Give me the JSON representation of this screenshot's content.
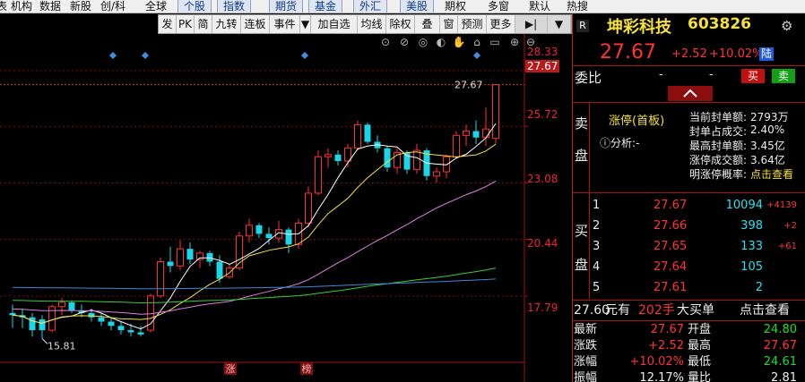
{
  "menu": {
    "items": [
      "表",
      "机构",
      "数据",
      "新股",
      "创/科",
      "全球",
      "个股",
      "指数",
      "期货",
      "基金",
      "外汇",
      "美股",
      "期权",
      "多窗",
      "默认",
      "热搜"
    ]
  },
  "toolbar": {
    "buttons": [
      "发",
      "PK",
      "简",
      "九转",
      "连板",
      "事件",
      "▼",
      "加自选",
      "均线",
      "除权",
      "叠",
      "窗",
      "预测",
      "更多",
      "▶|",
      "▼"
    ]
  },
  "chart_data": {
    "type": "candlestick",
    "y_ticks": [
      "28.33",
      "25.72",
      "23.08",
      "20.44",
      "17.79"
    ],
    "current_price_label": "27.67",
    "high_marker": "27.67",
    "low_marker": "15.81",
    "bottom_markers": [
      "涨",
      "榜"
    ],
    "ylim": [
      15.2,
      29.2
    ],
    "candles": [
      {
        "o": 17.0,
        "h": 17.4,
        "l": 16.3,
        "c": 16.9
      },
      {
        "o": 16.9,
        "h": 17.2,
        "l": 16.3,
        "c": 16.8
      },
      {
        "o": 16.8,
        "h": 17.0,
        "l": 15.9,
        "c": 16.2
      },
      {
        "o": 16.7,
        "h": 16.9,
        "l": 15.81,
        "c": 16.2
      },
      {
        "o": 16.2,
        "h": 17.4,
        "l": 16.1,
        "c": 17.3
      },
      {
        "o": 17.3,
        "h": 17.7,
        "l": 16.9,
        "c": 17.5
      },
      {
        "o": 17.5,
        "h": 17.6,
        "l": 17.0,
        "c": 17.1
      },
      {
        "o": 17.1,
        "h": 17.4,
        "l": 16.8,
        "c": 17.0
      },
      {
        "o": 17.0,
        "h": 17.2,
        "l": 16.6,
        "c": 16.8
      },
      {
        "o": 16.8,
        "h": 17.0,
        "l": 16.4,
        "c": 16.6
      },
      {
        "o": 16.6,
        "h": 16.8,
        "l": 16.2,
        "c": 16.4
      },
      {
        "o": 16.4,
        "h": 16.6,
        "l": 16.0,
        "c": 16.2
      },
      {
        "o": 16.2,
        "h": 16.5,
        "l": 15.9,
        "c": 16.1
      },
      {
        "o": 16.1,
        "h": 16.4,
        "l": 15.9,
        "c": 16.0
      },
      {
        "o": 16.2,
        "h": 17.9,
        "l": 16.1,
        "c": 17.8
      },
      {
        "o": 17.8,
        "h": 19.6,
        "l": 17.7,
        "c": 19.4
      },
      {
        "o": 19.4,
        "h": 20.1,
        "l": 18.9,
        "c": 19.2
      },
      {
        "o": 19.2,
        "h": 20.4,
        "l": 19.0,
        "c": 20.0
      },
      {
        "o": 20.0,
        "h": 20.3,
        "l": 19.3,
        "c": 19.5
      },
      {
        "o": 19.5,
        "h": 19.9,
        "l": 19.1,
        "c": 19.8
      },
      {
        "o": 19.8,
        "h": 19.9,
        "l": 19.2,
        "c": 19.4
      },
      {
        "o": 19.4,
        "h": 19.7,
        "l": 18.4,
        "c": 18.6
      },
      {
        "o": 18.7,
        "h": 19.3,
        "l": 18.6,
        "c": 19.1
      },
      {
        "o": 19.1,
        "h": 20.8,
        "l": 19.0,
        "c": 20.6
      },
      {
        "o": 20.6,
        "h": 21.4,
        "l": 20.3,
        "c": 21.1
      },
      {
        "o": 21.1,
        "h": 21.2,
        "l": 20.5,
        "c": 20.7
      },
      {
        "o": 20.7,
        "h": 21.0,
        "l": 20.2,
        "c": 20.5
      },
      {
        "o": 20.5,
        "h": 21.3,
        "l": 20.3,
        "c": 20.9
      },
      {
        "o": 20.9,
        "h": 21.0,
        "l": 19.8,
        "c": 20.2
      },
      {
        "o": 20.2,
        "h": 21.4,
        "l": 20.0,
        "c": 21.2
      },
      {
        "o": 21.2,
        "h": 22.9,
        "l": 21.0,
        "c": 22.6
      },
      {
        "o": 22.6,
        "h": 24.6,
        "l": 22.5,
        "c": 24.3
      },
      {
        "o": 24.3,
        "h": 24.7,
        "l": 23.8,
        "c": 24.4
      },
      {
        "o": 24.4,
        "h": 24.6,
        "l": 23.9,
        "c": 24.1
      },
      {
        "o": 24.1,
        "h": 24.9,
        "l": 23.8,
        "c": 24.7
      },
      {
        "o": 24.7,
        "h": 26.0,
        "l": 24.6,
        "c": 25.8
      },
      {
        "o": 25.8,
        "h": 25.9,
        "l": 24.9,
        "c": 25.0
      },
      {
        "o": 25.0,
        "h": 25.3,
        "l": 24.5,
        "c": 24.7
      },
      {
        "o": 24.7,
        "h": 24.8,
        "l": 23.6,
        "c": 23.8
      },
      {
        "o": 23.8,
        "h": 24.7,
        "l": 23.5,
        "c": 24.5
      },
      {
        "o": 24.5,
        "h": 24.6,
        "l": 23.5,
        "c": 23.7
      },
      {
        "o": 23.7,
        "h": 24.9,
        "l": 23.5,
        "c": 24.6
      },
      {
        "o": 24.6,
        "h": 24.7,
        "l": 23.2,
        "c": 23.4
      },
      {
        "o": 23.4,
        "h": 23.8,
        "l": 23.1,
        "c": 23.6
      },
      {
        "o": 23.6,
        "h": 24.4,
        "l": 23.3,
        "c": 24.3
      },
      {
        "o": 24.3,
        "h": 25.5,
        "l": 24.2,
        "c": 25.3
      },
      {
        "o": 25.3,
        "h": 25.8,
        "l": 24.8,
        "c": 25.5
      },
      {
        "o": 25.5,
        "h": 26.0,
        "l": 24.9,
        "c": 25.2
      },
      {
        "o": 25.2,
        "h": 26.6,
        "l": 24.8,
        "c": 25.6
      },
      {
        "o": 25.16,
        "h": 27.67,
        "l": 24.9,
        "c": 27.67
      }
    ],
    "ma_colors": [
      "#ffffff",
      "#f5e03c",
      "#e07fe0",
      "#35d035",
      "#3a8ad8"
    ]
  },
  "panel": {
    "name": "坤彩科技",
    "code": "603826",
    "price": "27.67",
    "change": "+2.52",
    "change_pct": "+10.02%",
    "exchange_badge": "陆",
    "r_badge": "R",
    "weibi_label": "委比",
    "weibi_value": "-",
    "weibi_value2": "-",
    "buy_btn": "买",
    "sell_btn": "卖",
    "sell_side_label": [
      "卖",
      "盘"
    ],
    "buy_side_label": [
      "买",
      "盘"
    ],
    "limit_tag": "涨停(首板)",
    "analysis_label": "分析:",
    "analysis_value": "-",
    "stats": [
      {
        "label": "当前封单额:",
        "value": "2793万"
      },
      {
        "label": "封单占成交:",
        "value": "2.40%"
      },
      {
        "label": "最高封单额:",
        "value": "3.45亿"
      },
      {
        "label": "涨停成交额:",
        "value": "3.64亿"
      },
      {
        "label": "明涨停概率:",
        "value": "点击查看"
      }
    ],
    "orderbook": [
      {
        "level": "1",
        "price": "27.67",
        "volume": "10094",
        "delta": "+4139"
      },
      {
        "level": "2",
        "price": "27.66",
        "volume": "398",
        "delta": "+2"
      },
      {
        "level": "3",
        "price": "27.65",
        "volume": "133",
        "delta": "+61"
      },
      {
        "level": "4",
        "price": "27.64",
        "volume": "105",
        "delta": ""
      },
      {
        "level": "5",
        "price": "27.61",
        "volume": "2",
        "delta": ""
      }
    ],
    "trade_bar": {
      "price": "27.60",
      "unit": "元有",
      "qty": "202手",
      "desc": "大买单",
      "link": "点击查看"
    },
    "quotes": [
      {
        "l1": "最新",
        "v1": "27.67",
        "c1": "red",
        "l2": "开盘",
        "v2": "24.80",
        "c2": "green"
      },
      {
        "l1": "涨跌",
        "v1": "+2.52",
        "c1": "red",
        "l2": "最高",
        "v2": "27.67",
        "c2": "red"
      },
      {
        "l1": "涨幅",
        "v1": "+10.02%",
        "c1": "red",
        "l2": "最低",
        "v2": "24.61",
        "c2": "green"
      },
      {
        "l1": "振幅",
        "v1": "12.17%",
        "c1": "white",
        "l2": "量比",
        "v2": "2.81",
        "c2": "white"
      }
    ]
  }
}
